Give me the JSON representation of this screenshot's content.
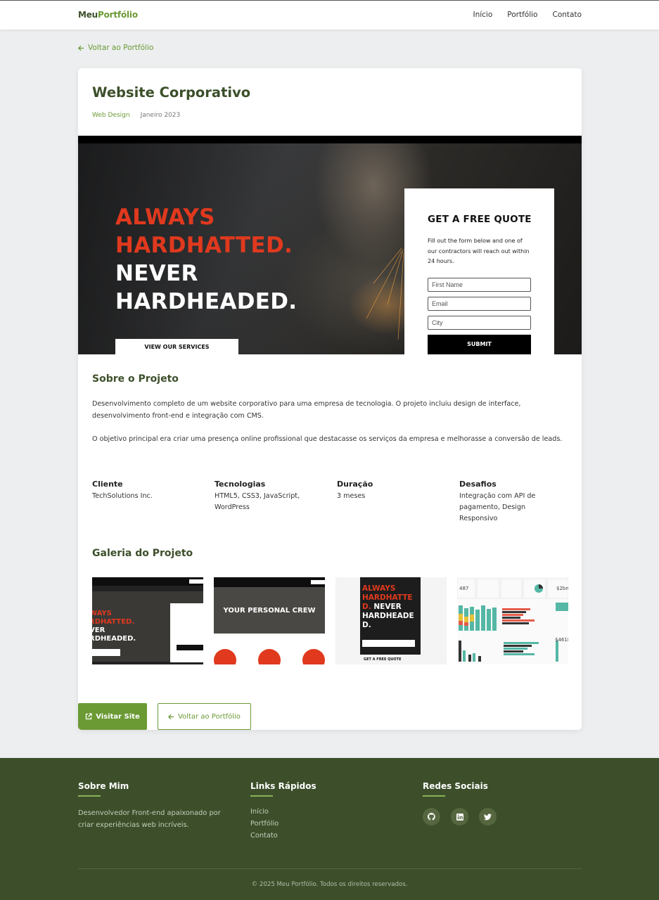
{
  "header": {
    "logo_part1": "Meu",
    "logo_part2": "Portfólio",
    "nav": [
      "Início",
      "Portfólio",
      "Contato"
    ]
  },
  "back_link_top": "Voltar ao Portfólio",
  "project": {
    "title": "Website Corporativo",
    "category": "Web Design",
    "date": "Janeiro 2023"
  },
  "hero": {
    "headline_red": [
      "ALWAYS",
      "HARDHATTED."
    ],
    "headline_white": [
      "NEVER",
      "HARDHEADED."
    ],
    "services_button": "VIEW OUR SERVICES",
    "quote_title": "GET A FREE QUOTE",
    "quote_text": "Fill out the form below and one of our contractors will reach out within 24 hours.",
    "fields": [
      "First Name",
      "Email",
      "City"
    ],
    "submit": "SUBMIT"
  },
  "about": {
    "heading": "Sobre o Projeto",
    "p1": "Desenvolvimento completo de um website corporativo para uma empresa de tecnologia. O projeto incluiu design de interface, desenvolvimento front-end e integração com CMS.",
    "p2": "O objetivo principal era criar uma presença online profissional que destacasse os serviços da empresa e melhorasse a conversão de leads."
  },
  "info": [
    {
      "label": "Cliente",
      "value": "TechSolutions Inc."
    },
    {
      "label": "Tecnologias",
      "value": "HTML5, CSS3, JavaScript, WordPress"
    },
    {
      "label": "Duração",
      "value": "3 meses"
    },
    {
      "label": "Desafios",
      "value": "Integração com API de pagamento, Design Responsivo"
    }
  ],
  "gallery": {
    "heading": "Galeria do Projeto",
    "thumb2_text": "YOUR PERSONAL CREW",
    "thumb3_lines": [
      "ALWAYS",
      "HARDHATTE",
      "D.",
      "NEVER",
      "HARDHEADE",
      "D."
    ],
    "thumb3_button": "GET A FREE QUOTE",
    "thumb4_numbers": [
      "487",
      "$2bn",
      "$461M"
    ]
  },
  "actions": {
    "visit": "Visitar Site",
    "back": "Voltar ao Portfólio"
  },
  "footer": {
    "about_title": "Sobre Mim",
    "about_text": "Desenvolvedor Front-end apaixonado por criar experiências web incríveis.",
    "links_title": "Links Rápidos",
    "links": [
      "Início",
      "Portfólio",
      "Contato"
    ],
    "social_title": "Redes Sociais",
    "socials": [
      "github-icon",
      "linkedin-icon",
      "twitter-icon"
    ],
    "copyright": "© 2025 Meu Portfólio. Todos os direitos reservados."
  },
  "colors": {
    "brand_dark": "#3c4f2a",
    "brand_green": "#6b9a35",
    "hero_red": "#e0391e"
  }
}
